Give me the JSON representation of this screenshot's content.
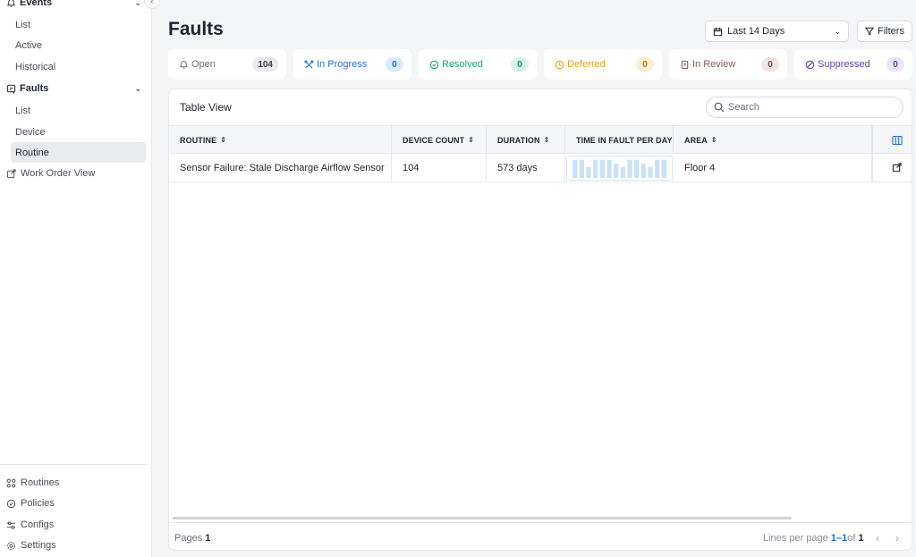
{
  "sidebar": {
    "sections": [
      {
        "label": "Events",
        "icon": "bell-icon",
        "items": [
          "List",
          "Active",
          "Historical"
        ]
      },
      {
        "label": "Faults",
        "icon": "fault-icon",
        "items": [
          "List",
          "Device",
          "Routine"
        ],
        "active_item": "Routine"
      }
    ],
    "work_order_view": "Work Order View",
    "bottom_links": [
      "Routines",
      "Policies",
      "Configs",
      "Settings"
    ]
  },
  "header": {
    "title": "Faults",
    "date_range": "Last 14 Days",
    "filters_label": "Filters"
  },
  "status_tabs": [
    {
      "label": "Open",
      "count": "104",
      "color": "#6b7080",
      "badge_bg": "#e9eaee",
      "badge_fg": "#3a3f4b"
    },
    {
      "label": "In Progress",
      "count": "0",
      "color": "#1f6fd1",
      "badge_bg": "#dbeafa",
      "badge_fg": "#1f6fd1"
    },
    {
      "label": "Resolved",
      "count": "0",
      "color": "#1aa27a",
      "badge_bg": "#d8f3e9",
      "badge_fg": "#138a66"
    },
    {
      "label": "Deferred",
      "count": "0",
      "color": "#e39a1b",
      "badge_bg": "#fbefd6",
      "badge_fg": "#b9790f"
    },
    {
      "label": "In Review",
      "count": "0",
      "color": "#8a5a55",
      "badge_bg": "#f1e6e4",
      "badge_fg": "#7a4a45"
    },
    {
      "label": "Suppressed",
      "count": "0",
      "color": "#6a3fa0",
      "badge_bg": "#ece4f6",
      "badge_fg": "#6a3fa0"
    }
  ],
  "table": {
    "title": "Table View",
    "search_placeholder": "Search",
    "columns": [
      "ROUTINE",
      "DEVICE COUNT",
      "DURATION",
      "TIME IN FAULT PER DAY",
      "AREA"
    ],
    "rows": [
      {
        "routine": "Sensor Failure: Stale Discharge Airflow Sensor",
        "device_count": "104",
        "duration": "573 days",
        "time_in_fault_per_day": [
          0.92,
          0.92,
          0.55,
          0.92,
          0.92,
          0.92,
          0.72,
          0.55,
          0.92,
          0.92,
          0.72,
          0.55,
          0.92,
          0.92
        ],
        "area": "Floor 4"
      }
    ],
    "spark_color": "#c9e1f6"
  },
  "footer": {
    "pages_label": "Pages",
    "pages_value": "1",
    "lines_label": "Lines per page",
    "lines_range": "1–1",
    "of_label": "of",
    "lines_total": "1"
  }
}
